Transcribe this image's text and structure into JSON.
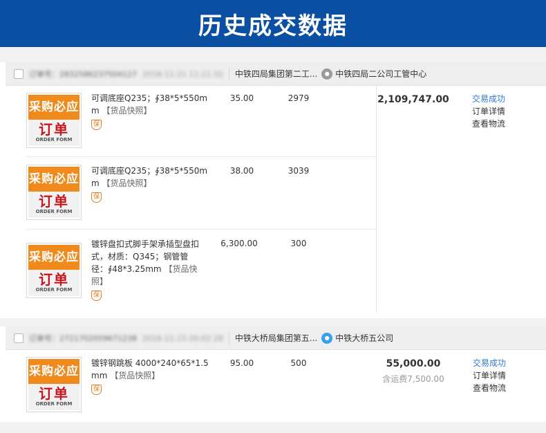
{
  "banner": {
    "title": "历史成交数据"
  },
  "orders": [
    {
      "order_no": "订单号：2832586237504127",
      "order_time": "2016-11-21 11:11:32",
      "buyer": "中铁四局集团第二工...",
      "seller": "中铁四局二公司工管中心",
      "total": "2,109,747.00",
      "status": "交易成功",
      "detail_link": "订单详情",
      "logistics_link": "查看物流",
      "items": [
        {
          "thumb_top": "采购必应",
          "thumb_main": "订单",
          "thumb_en": "ORDER FORM",
          "name": "可调底座Q235；∮38*5*550mm",
          "snapshot": "【货品快照】",
          "guarantee": "保",
          "price": "35.00",
          "qty": "2979"
        },
        {
          "thumb_top": "采购必应",
          "thumb_main": "订单",
          "thumb_en": "ORDER FORM",
          "name": "可调底座Q235；∮38*5*550mm",
          "snapshot": "【货品快照】",
          "guarantee": "保",
          "price": "38.00",
          "qty": "3039"
        },
        {
          "thumb_top": "采购必应",
          "thumb_main": "订单",
          "thumb_en": "ORDER FORM",
          "name": "镀锌盘扣式脚手架承插型盘扣式，材质：Q345；钢管管径：∮48*3.25mm",
          "snapshot": "【货品快照】",
          "guarantee": "保",
          "price": "6,300.00",
          "qty": "300"
        }
      ]
    },
    {
      "order_no": "订单号：2721702059671238",
      "order_time": "2016-11-15 09:02:28",
      "buyer": "中铁大桥局集团第五...",
      "seller": "中铁大桥五公司",
      "total": "55,000.00",
      "shipping": "含运费7,500.00",
      "status": "交易成功",
      "detail_link": "订单详情",
      "logistics_link": "查看物流",
      "items": [
        {
          "thumb_top": "采购必应",
          "thumb_main": "订单",
          "thumb_en": "ORDER FORM",
          "name": "镀锌钢跳板 4000*240*65*1.5mm",
          "snapshot": "【货品快照】",
          "guarantee": "保",
          "price": "95.00",
          "qty": "500"
        }
      ]
    }
  ]
}
